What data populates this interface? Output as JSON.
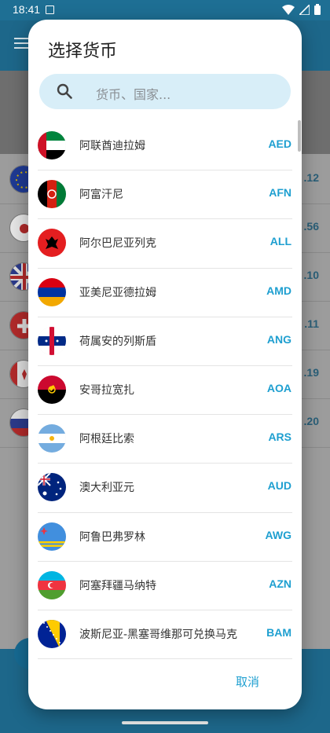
{
  "status_bar": {
    "time": "18:41"
  },
  "background": {
    "rows": [
      {
        "value": ".12"
      },
      {
        "value": ".56"
      },
      {
        "value": ".10"
      },
      {
        "value": ".11"
      },
      {
        "value": ".19"
      },
      {
        "value": ".20"
      }
    ]
  },
  "dialog": {
    "title": "选择货币",
    "search": {
      "placeholder": "货币、国家..."
    },
    "cancel_label": "取消",
    "currencies": [
      {
        "name": "阿联酋迪拉姆",
        "code": "AED"
      },
      {
        "name": "阿富汗尼",
        "code": "AFN"
      },
      {
        "name": "阿尔巴尼亚列克",
        "code": "ALL"
      },
      {
        "name": "亚美尼亚德拉姆",
        "code": "AMD"
      },
      {
        "name": "荷属安的列斯盾",
        "code": "ANG"
      },
      {
        "name": "安哥拉宽扎",
        "code": "AOA"
      },
      {
        "name": "阿根廷比索",
        "code": "ARS"
      },
      {
        "name": "澳大利亚元",
        "code": "AUD"
      },
      {
        "name": "阿鲁巴弗罗林",
        "code": "AWG"
      },
      {
        "name": "阿塞拜疆马纳特",
        "code": "AZN"
      },
      {
        "name": "波斯尼亚-黑塞哥维那可兑换马克",
        "code": "BAM"
      }
    ]
  },
  "colors": {
    "accent": "#1e9fd0",
    "search_bg": "#d8eef8",
    "appbar": "#1d678a"
  }
}
